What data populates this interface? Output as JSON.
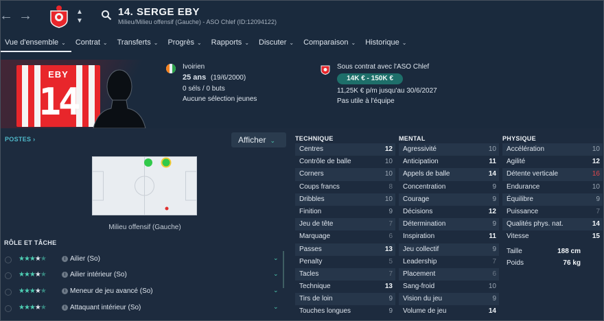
{
  "nav": {
    "back_icon": "arrow-left-icon",
    "forward_icon": "arrow-right-icon",
    "search_icon": "search-icon"
  },
  "header": {
    "player_title": "14. SERGE EBY",
    "subtitle": "Milieu/Milieu offensif (Gauche) - ASO Chlef (ID:12094122)"
  },
  "tabs": [
    {
      "label": "Vue d'ensemble",
      "active": true
    },
    {
      "label": "Contrat"
    },
    {
      "label": "Transferts"
    },
    {
      "label": "Progrès"
    },
    {
      "label": "Rapports"
    },
    {
      "label": "Discuter"
    },
    {
      "label": "Comparaison"
    },
    {
      "label": "Historique"
    }
  ],
  "shirt": {
    "name": "EBY",
    "number": "14"
  },
  "bio": {
    "nationality": "Ivoirien",
    "age": "25 ans",
    "birthdate": "(19/6/2000)",
    "caps": "0 séls / 0 buts",
    "youth": "Aucune sélection jeunes"
  },
  "contract": {
    "line": "Sous contrat avec l'ASO Chlef",
    "value_range": "14K € - 150K €",
    "wage": "11,25K € p/m jusqu'au 30/6/2027",
    "status": "Pas utile à l'équipe"
  },
  "positions": {
    "heading": "POSTES",
    "filter_label": "Afficher",
    "position_label": "Milieu offensif (Gauche)"
  },
  "roles": {
    "heading": "RÔLE ET TÂCHE",
    "items": [
      {
        "name": "Ailier (So)",
        "stars": 3.5
      },
      {
        "name": "Ailier intérieur (So)",
        "stars": 3.5
      },
      {
        "name": "Meneur de jeu avancé (So)",
        "stars": 3.5
      },
      {
        "name": "Attaquant intérieur (So)",
        "stars": 3.5
      }
    ]
  },
  "technique": {
    "heading": "TECHNIQUE",
    "attrs": [
      {
        "name": "Centres",
        "value": "12"
      },
      {
        "name": "Contrôle de balle",
        "value": "10"
      },
      {
        "name": "Corners",
        "value": "10"
      },
      {
        "name": "Coups francs",
        "value": "8"
      },
      {
        "name": "Dribbles",
        "value": "10"
      },
      {
        "name": "Finition",
        "value": "9"
      },
      {
        "name": "Jeu de tête",
        "value": "7"
      },
      {
        "name": "Marquage",
        "value": "6"
      },
      {
        "name": "Passes",
        "value": "13"
      },
      {
        "name": "Penalty",
        "value": "5"
      },
      {
        "name": "Tacles",
        "value": "7"
      },
      {
        "name": "Technique",
        "value": "13"
      },
      {
        "name": "Tirs de loin",
        "value": "9"
      },
      {
        "name": "Touches longues",
        "value": "9"
      }
    ]
  },
  "mental": {
    "heading": "MENTAL",
    "attrs": [
      {
        "name": "Agressivité",
        "value": "10"
      },
      {
        "name": "Anticipation",
        "value": "11"
      },
      {
        "name": "Appels de balle",
        "value": "14"
      },
      {
        "name": "Concentration",
        "value": "9"
      },
      {
        "name": "Courage",
        "value": "9"
      },
      {
        "name": "Décisions",
        "value": "12"
      },
      {
        "name": "Détermination",
        "value": "9"
      },
      {
        "name": "Inspiration",
        "value": "11"
      },
      {
        "name": "Jeu collectif",
        "value": "9"
      },
      {
        "name": "Leadership",
        "value": "7"
      },
      {
        "name": "Placement",
        "value": "6"
      },
      {
        "name": "Sang-froid",
        "value": "10"
      },
      {
        "name": "Vision du jeu",
        "value": "9"
      },
      {
        "name": "Volume de jeu",
        "value": "14"
      }
    ]
  },
  "physique": {
    "heading": "PHYSIQUE",
    "attrs": [
      {
        "name": "Accélération",
        "value": "10"
      },
      {
        "name": "Agilité",
        "value": "12"
      },
      {
        "name": "Détente verticale",
        "value": "16"
      },
      {
        "name": "Endurance",
        "value": "10"
      },
      {
        "name": "Équilibre",
        "value": "9"
      },
      {
        "name": "Puissance",
        "value": "7"
      },
      {
        "name": "Qualités phys. nat.",
        "value": "14"
      },
      {
        "name": "Vitesse",
        "value": "15"
      }
    ],
    "height_label": "Taille",
    "height": "188 cm",
    "weight_label": "Poids",
    "weight": "76 kg"
  },
  "colors": {
    "accent": "#4ecdb3",
    "shirt_red": "#e8262b",
    "attr_red": "#e0474c",
    "pill": "#1e6f6a"
  }
}
